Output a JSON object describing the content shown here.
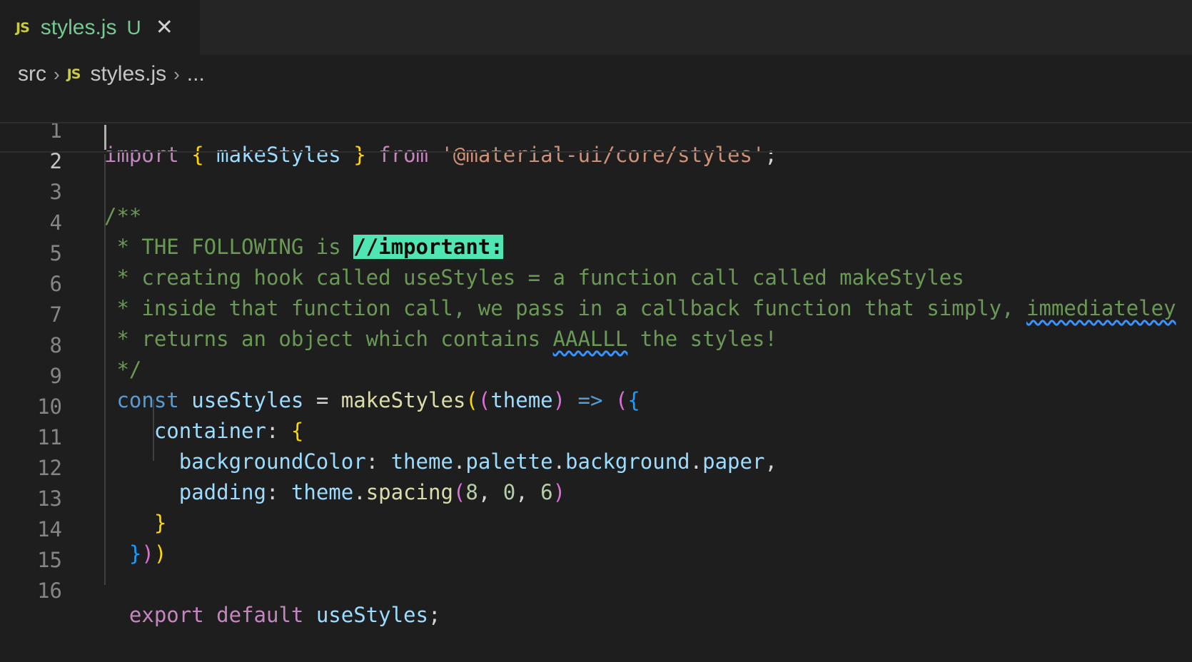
{
  "tab": {
    "icon": "javascript-file-icon",
    "badge": "JS",
    "filename": "styles.js",
    "status": "U",
    "close_glyph": "✕",
    "colors": {
      "filename": "#73c991",
      "badge": "#cbcb41"
    }
  },
  "breadcrumb": {
    "folder": "src",
    "separator": "›",
    "badge": "JS",
    "file": "styles.js",
    "ellipsis": "..."
  },
  "editor": {
    "active_line": 2,
    "line_numbers": [
      "1",
      "2",
      "3",
      "4",
      "5",
      "6",
      "7",
      "8",
      "9",
      "10",
      "11",
      "12",
      "13",
      "14",
      "15",
      "16"
    ],
    "tokens": {
      "l1": [
        "import",
        " ",
        "{",
        " makeStyles ",
        "}",
        " from ",
        "'@material-ui/core/styles'",
        ";"
      ],
      "l3": "/**",
      "l4": [
        " * THE FOLLOWING is ",
        "//important:"
      ],
      "l5": " * creating hook called useStyles = a function call called makeStyles",
      "l6": [
        " * inside that function call, we pass in a callback function that simply, ",
        "immediateley"
      ],
      "l7": [
        " * returns an object which contains ",
        "AAALLL",
        " the styles!"
      ],
      "l8": " */",
      "l9": [
        " const",
        " ",
        "useStyles",
        " = ",
        "makeStyles",
        "(",
        "(",
        "theme",
        ")",
        " => ",
        "(",
        "{"
      ],
      "l10": [
        "    container",
        ": ",
        "{"
      ],
      "l11": [
        "      backgroundColor",
        ": ",
        "theme",
        ".",
        "palette",
        ".",
        "background",
        ".",
        "paper",
        ","
      ],
      "l12": [
        "      padding",
        ": ",
        "theme",
        ".",
        "spacing",
        "(",
        "8",
        ", ",
        "0",
        ", ",
        "6",
        ")"
      ],
      "l13": [
        "    ",
        "}"
      ],
      "l14": [
        "  ",
        "}",
        ")",
        ")"
      ],
      "l16": [
        "  export",
        " ",
        "default",
        " ",
        "useStyles",
        ";"
      ]
    },
    "colors": {
      "background": "#1e1e1e",
      "keyword": "#c586c0",
      "declaration": "#569cd6",
      "variable": "#9cdcfe",
      "function": "#dcdcaa",
      "string": "#ce9178",
      "number": "#b5cea8",
      "comment": "#6a9955",
      "highlight": "#50e6b4"
    }
  }
}
